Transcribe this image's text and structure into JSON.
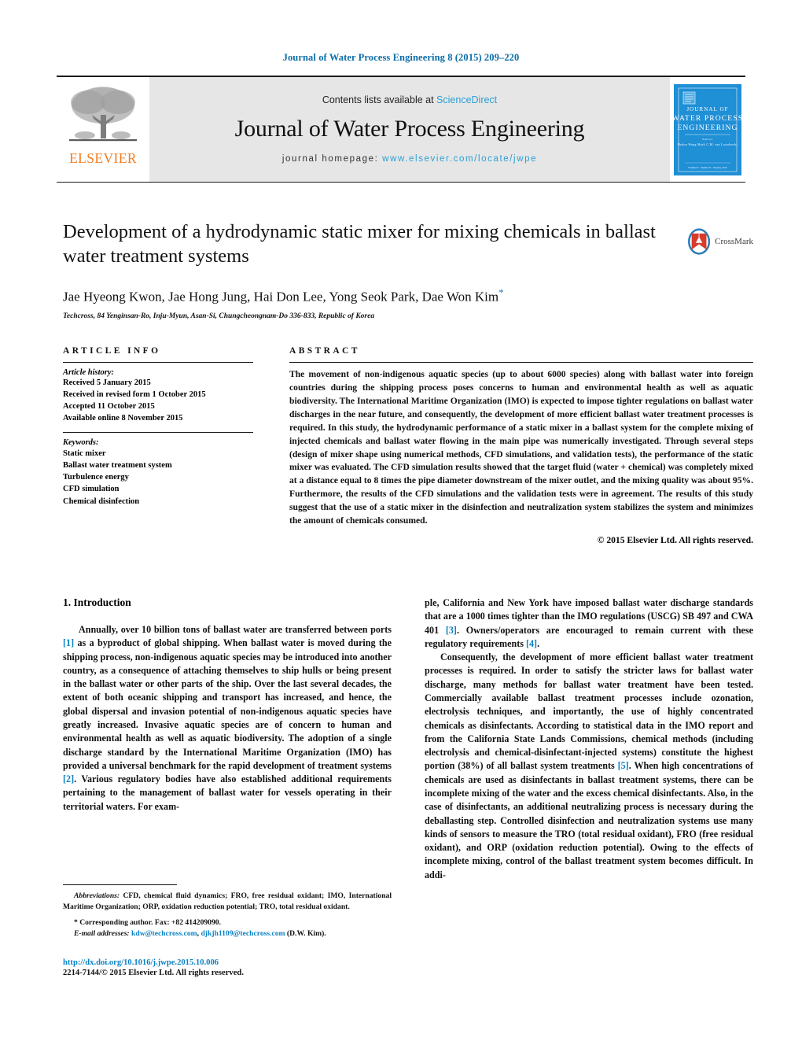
{
  "running_head": "Journal of Water Process Engineering 8 (2015) 209–220",
  "masthead": {
    "contents_prefix": "Contents lists available at ",
    "sciencedirect": "ScienceDirect",
    "journal_title": "Journal of Water Process Engineering",
    "homepage_prefix": "journal homepage: ",
    "homepage_url": "www.elsevier.com/locate/jwpe",
    "publisher_wordmark": "ELSEVIER",
    "cover": {
      "line1": "JOURNAL OF",
      "line2": "WATER PROCESS",
      "line3": "ENGINEERING",
      "editors_label": "Editors",
      "editors": "Hodon Wang    Mark C.M. van Loosdrecht",
      "footer": "Volume 8 · number 8 · January 2015",
      "color": "#1f8fd6"
    }
  },
  "article": {
    "title": "Development of a hydrodynamic static mixer for mixing chemicals in ballast water treatment systems",
    "authors": "Jae Hyeong Kwon, Jae Hong Jung, Hai Don Lee, Yong Seok Park, Dae Won Kim",
    "corresponding_marker": "*",
    "affiliation": "Techcross, 84 Yenginsan-Ro, Inju-Myun, Asan-Si, Chungcheongnam-Do 336-833, Republic of Korea",
    "crossmark_label": "CrossMark"
  },
  "article_info": {
    "heading": "ARTICLE INFO",
    "history_label": "Article history:",
    "history": [
      "Received 5 January 2015",
      "Received in revised form 1 October 2015",
      "Accepted 11 October 2015",
      "Available online 8 November 2015"
    ],
    "keywords_label": "Keywords:",
    "keywords": [
      "Static mixer",
      "Ballast water treatment system",
      "Turbulence energy",
      "CFD simulation",
      "Chemical disinfection"
    ]
  },
  "abstract": {
    "heading": "ABSTRACT",
    "body": "The movement of non-indigenous aquatic species (up to about 6000 species) along with ballast water into foreign countries during the shipping process poses concerns to human and environmental health as well as aquatic biodiversity. The International Maritime Organization (IMO) is expected to impose tighter regulations on ballast water discharges in the near future, and consequently, the development of more efficient ballast water treatment processes is required. In this study, the hydrodynamic performance of a static mixer in a ballast system for the complete mixing of injected chemicals and ballast water flowing in the main pipe was numerically investigated. Through several steps (design of mixer shape using numerical methods, CFD simulations, and validation tests), the performance of the static mixer was evaluated. The CFD simulation results showed that the target fluid (water + chemical) was completely mixed at a distance equal to 8 times the pipe diameter downstream of the mixer outlet, and the mixing quality was about 95%. Furthermore, the results of the CFD simulations and the validation tests were in agreement. The results of this study suggest that the use of a static mixer in the disinfection and neutralization system stabilizes the system and minimizes the amount of chemicals consumed.",
    "copyright": "© 2015 Elsevier Ltd. All rights reserved."
  },
  "introduction": {
    "heading": "1.  Introduction",
    "left_para1_a": "Annually, over 10 billion tons of ballast water are transferred between ports ",
    "left_para1_cite1": "[1]",
    "left_para1_b": " as a byproduct of global shipping. When ballast water is moved during the shipping process, non-indigenous aquatic species may be introduced into another country, as a consequence of attaching themselves to ship hulls or being present in the ballast water or other parts of the ship. Over the last several decades, the extent of both oceanic shipping and transport has increased, and hence, the global dispersal and invasion potential of non-indigenous aquatic species have greatly increased. Invasive aquatic species are of concern to human and environmental health as well as aquatic biodiversity. The adoption of a single discharge standard by the International Maritime Organization (IMO) has provided a universal benchmark for the rapid development of treatment systems ",
    "left_para1_cite2": "[2]",
    "left_para1_c": ". Various regulatory bodies have also established additional requirements pertaining to the management of ballast water for vessels operating in their territorial waters. For exam-",
    "right_para1_a": "ple, California and New York have imposed ballast water discharge standards that are a 1000 times tighter than the IMO regulations (USCG) SB 497 and CWA 401 ",
    "right_para1_cite1": "[3]",
    "right_para1_b": ". Owners/operators are encouraged to remain current with these regulatory requirements ",
    "right_para1_cite2": "[4]",
    "right_para1_c": ".",
    "right_para2_a": "Consequently, the development of more efficient ballast water treatment processes is required. In order to satisfy the stricter laws for ballast water discharge, many methods for ballast water treatment have been tested. Commercially available ballast treatment processes include ozonation, electrolysis techniques, and importantly, the use of highly concentrated chemicals as disinfectants. According to statistical data in the IMO report and from the California State Lands Commissions, chemical methods (including electrolysis and chemical-disinfectant-injected systems) constitute the highest portion (38%) of all ballast system treatments ",
    "right_para2_cite1": "[5]",
    "right_para2_b": ". When high concentrations of chemicals are used as disinfectants in ballast treatment systems, there can be incomplete mixing of the water and the excess chemical disinfectants. Also, in the case of disinfectants, an additional neutralizing process is necessary during the deballasting step. Controlled disinfection and neutralization systems use many kinds of sensors to measure the TRO (total residual oxidant), FRO (free residual oxidant), and ORP (oxidation reduction potential). Owing to the effects of incomplete mixing, control of the ballast treatment system becomes difficult. In addi-"
  },
  "footnotes": {
    "abbrev_label": "Abbreviations:",
    "abbrev_text": "  CFD, chemical fluid dynamics; FRO, free residual oxidant; IMO, International Maritime Organization; ORP, oxidation reduction potential; TRO, total residual oxidant.",
    "corresponding_marker": "*",
    "corresponding_text": "Corresponding author. Fax: +82 414209090.",
    "email_label": "E-mail addresses:",
    "email1": "kdw@techcross.com",
    "email_sep": ", ",
    "email2": "djkjh1109@techcross.com",
    "email_suffix": " (D.W. Kim)."
  },
  "doi": {
    "url": "http://dx.doi.org/10.1016/j.jwpe.2015.10.006",
    "issn_line": "2214-7144/© 2015 Elsevier Ltd. All rights reserved."
  }
}
